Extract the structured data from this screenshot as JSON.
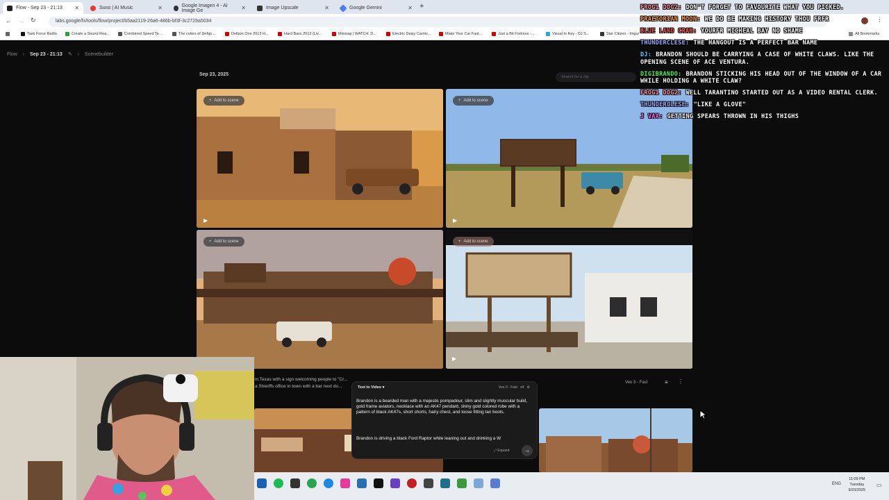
{
  "browser": {
    "tabs": [
      {
        "label": "Flow - Sep 23 - 21:13",
        "color": "#222222",
        "active": true
      },
      {
        "label": "Suno | AI Music",
        "color": "#e03e2f",
        "active": false
      },
      {
        "label": "Google Imagen 4 - AI Image Ge",
        "color": "#333333",
        "active": false
      },
      {
        "label": "Image Upscale",
        "color": "#333333",
        "active": false
      },
      {
        "label": "Google Gemini",
        "color": "#4a7ef0",
        "active": false
      }
    ],
    "new_tab": "+",
    "url": "labs.google/fx/tools/flow/project/b5aa2119-26a6-486b-bf3f-3c2729a5034",
    "bookmarks": [
      {
        "label": "Task Force Radio",
        "color": "#111111"
      },
      {
        "label": "Create a Sound Rea...",
        "color": "#2e9e3e"
      },
      {
        "label": "Combined Speed Te...",
        "color": "#555555"
      },
      {
        "label": "The colors of Defqo...",
        "color": "#555555"
      },
      {
        "label": "Defqon One 2013 H...",
        "color": "#cc0000"
      },
      {
        "label": "Hard Bass 2013 (Liv...",
        "color": "#cc0000"
      },
      {
        "label": "Mixmag | WATCH: D...",
        "color": "#cc0000"
      },
      {
        "label": "Electric Daisy Carniv...",
        "color": "#cc0000"
      },
      {
        "label": "Make Your Car Fast...",
        "color": "#cc0000"
      },
      {
        "label": "Just a Bit Fortress -...",
        "color": "#cc0000"
      },
      {
        "label": "Visual In Key - DJ S...",
        "color": "#2aa7d8"
      },
      {
        "label": "Star Citizen - Imgur",
        "color": "#333333"
      }
    ],
    "all_bookmarks": "All Bookmarks"
  },
  "app": {
    "breadcrumb": {
      "root": "Flow",
      "project": "Sep 23 - 21:13",
      "section": "Scenebuilder"
    },
    "date_label": "Sep 23, 2025",
    "search_placeholder": "Search for a clip",
    "add_to_scene": "Add to scene",
    "model_label": "Veo 3 - Fast",
    "caption_line1": "in Texas with a sign welcoming people to \"Cr...",
    "caption_line2": "a Sheriffs office in town with a bar next do..."
  },
  "prompt": {
    "mode": "Text to Video",
    "model": "Veo 3 - Fast",
    "count": "x4",
    "text_main": "Brandon is a bearded man with a majestic pompadour, slim and slightly muscular build, gold frame aviators, necklace with an AK47 pendant, shiny gold colored robe with a pattern of black AK47s, short shorts, hairy chest, and loose fitting tan boots.",
    "text_current": "Brandon is driving a black Ford Raptor while leaning out and drinking a W",
    "expand_label": "Expand"
  },
  "chat": [
    {
      "user": "Frog1 Dog2:",
      "color": "#ff8fa3",
      "text": "Don't forget to favourite what you picked."
    },
    {
      "user": "Praetorian Moon:",
      "color": "#ff9f3f",
      "text": "We do be making history thou frfr"
    },
    {
      "user": "Blue Land Crab:",
      "color": "#ff5a5a",
      "text": "Yourfr Micheal Bay no shame"
    },
    {
      "user": "Thunderclese:",
      "color": "#9aa9ff",
      "text": "The Hangout is a perfect bar name"
    },
    {
      "user": "DJ:",
      "color": "#5fd3ff",
      "text": "Brandon should be carrying a case of White Claws. Like the opening scene of Ace Ventura."
    },
    {
      "user": "DigiBrando:",
      "color": "#4ff05a",
      "text": "Brandon sticking his head out of the window of a car while holding a White Claw?"
    },
    {
      "user": "Frog1 Dog2:",
      "color": "#ff8fa3",
      "text": "Well Tarantino started out as a video rental clerk."
    },
    {
      "user": "Thunderclese:",
      "color": "#9aa9ff",
      "text": "\"like a glove\""
    },
    {
      "user": "J Vax:",
      "color": "#ff66ff",
      "text": "getting spears thrown in his thighs"
    }
  ],
  "tray": {
    "lang": "ENG",
    "time": "11:09 PM",
    "day": "Tuesday",
    "date": "9/23/2025"
  }
}
